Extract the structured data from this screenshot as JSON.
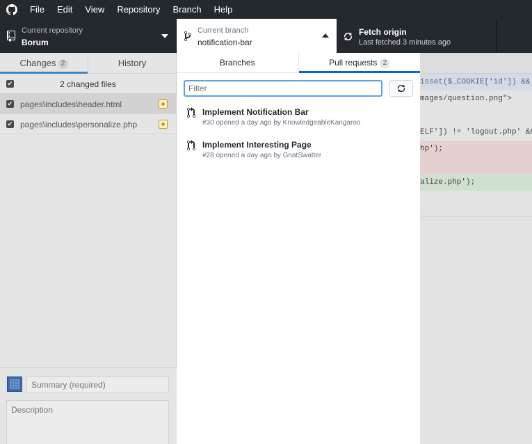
{
  "menu": [
    "File",
    "Edit",
    "View",
    "Repository",
    "Branch",
    "Help"
  ],
  "toolbar": {
    "repo_label": "Current repository",
    "repo_value": "Borum",
    "branch_label": "Current branch",
    "branch_value": "notification-bar",
    "fetch_label": "Fetch origin",
    "fetch_value": "Last fetched 3 minutes ago"
  },
  "sidebar": {
    "tab_changes": "Changes",
    "tab_changes_count": "2",
    "tab_history": "History",
    "changed_files": "2 changed files",
    "files": [
      {
        "name": "pages\\includes\\header.html"
      },
      {
        "name": "pages\\includes\\personalize.php"
      }
    ],
    "summary_placeholder": "Summary (required)",
    "description_placeholder": "Description"
  },
  "popover": {
    "tab_branches": "Branches",
    "tab_pull_requests": "Pull requests",
    "pr_count": "2",
    "filter_placeholder": "Filter",
    "pull_requests": [
      {
        "title": "Implement Notification Bar",
        "subtitle": "#30 opened a day ago by KnowledgeableKangaroo"
      },
      {
        "title": "Implement Interesting Page",
        "subtitle": "#28 opened a day ago by GnatSwatter"
      }
    ]
  },
  "code": {
    "lines": [
      "isset($_COOKIE['id']) && in",
      "mages/question.png\">",
      "",
      "ELF']) != 'logout.php' && L",
      "hp');",
      "",
      "alize.php');"
    ]
  },
  "colors": {
    "accent": "#0366d6",
    "toolbar_bg": "#24292e"
  }
}
